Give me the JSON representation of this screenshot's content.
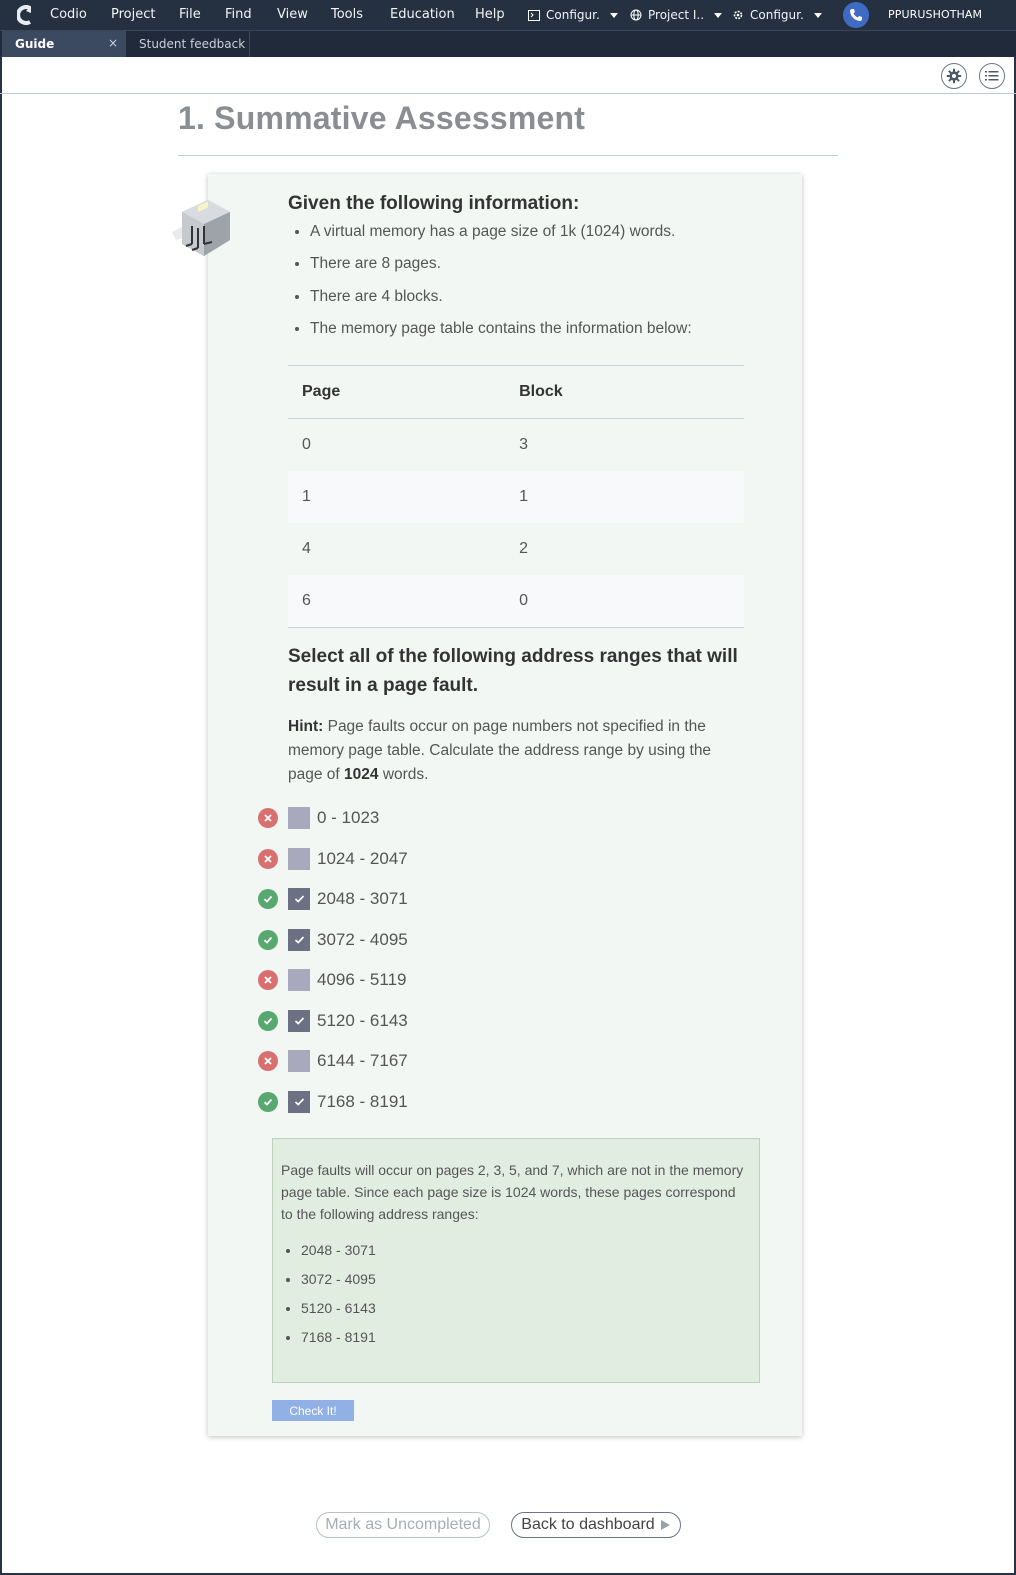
{
  "menubar": {
    "items": [
      "Codio",
      "Project",
      "File",
      "Find",
      "View",
      "Tools",
      "Education",
      "Help"
    ],
    "config1": "Configur.",
    "project_index": "Project I..",
    "config2": "Configur.",
    "user": "PPURUSHOTHAM"
  },
  "tabs": [
    {
      "label": "Guide",
      "close": "×"
    },
    {
      "label": "Student feedback"
    }
  ],
  "page": {
    "title": "1. Summative Assessment"
  },
  "info": {
    "heading": "Given the following information:",
    "bullets": [
      "A virtual memory has a page size of 1k (1024) words.",
      "There are 8 pages.",
      "There are 4 blocks.",
      "The memory page table contains the information below:"
    ]
  },
  "page_table": {
    "headers": [
      "Page",
      "Block"
    ],
    "rows": [
      [
        "0",
        "3"
      ],
      [
        "1",
        "1"
      ],
      [
        "4",
        "2"
      ],
      [
        "6",
        "0"
      ]
    ]
  },
  "question": {
    "heading": "Select all of the following address ranges that will result in a page fault.",
    "hint_label": "Hint:",
    "hint_text_1": " Page faults occur on page numbers not specified in the memory page table. Calculate the address range by using the page of ",
    "hint_bold": "1024",
    "hint_text_2": " words."
  },
  "options": [
    {
      "label": "0 - 1023",
      "checked": false,
      "correct": false
    },
    {
      "label": "1024 - 2047",
      "checked": false,
      "correct": false
    },
    {
      "label": "2048 - 3071",
      "checked": true,
      "correct": true
    },
    {
      "label": "3072 - 4095",
      "checked": true,
      "correct": true
    },
    {
      "label": "4096 - 5119",
      "checked": false,
      "correct": false
    },
    {
      "label": "5120 - 6143",
      "checked": true,
      "correct": true
    },
    {
      "label": "6144 - 7167",
      "checked": false,
      "correct": false
    },
    {
      "label": "7168 - 8191",
      "checked": true,
      "correct": true
    }
  ],
  "feedback": {
    "text": "Page faults will occur on pages 2, 3, 5, and 7, which are not in the memory page table. Since each page size is 1024 words, these pages correspond to the following address ranges:",
    "ranges": [
      "2048 - 3071",
      "3072 - 4095",
      "5120 - 6143",
      "7168 - 8191"
    ]
  },
  "buttons": {
    "check": "Check It!",
    "mark_uncompleted": "Mark as Uncompleted",
    "back_to_dashboard": "Back to dashboard"
  },
  "colors": {
    "menubar": "#253041",
    "card_bg": "#f2f7f4",
    "feedback_bg": "#e2ede2",
    "correct": "#58a870",
    "incorrect": "#d97070",
    "check_button": "#90b0e6"
  }
}
